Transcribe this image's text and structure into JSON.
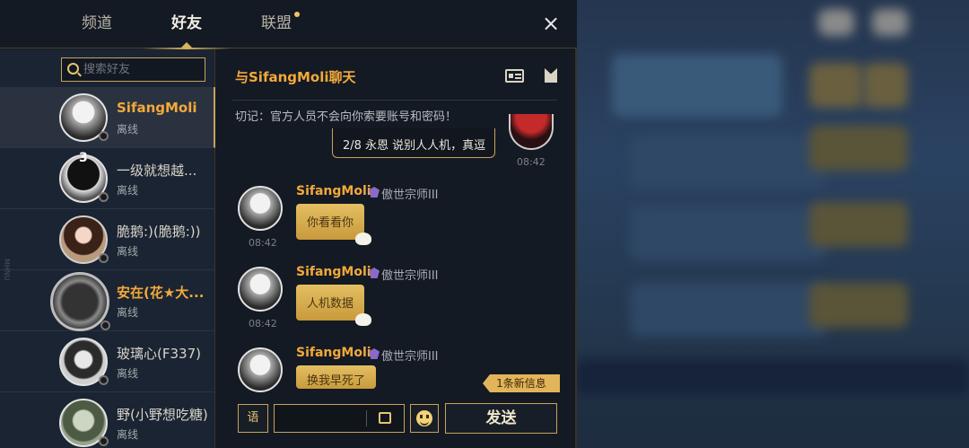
{
  "tabs": [
    {
      "label": "频道"
    },
    {
      "label": "好友"
    },
    {
      "label": "联盟"
    }
  ],
  "close_icon": "×",
  "search": {
    "placeholder": "搜索好友"
  },
  "side_label": "MHNU",
  "friends": [
    {
      "name": "SifangMoli",
      "status": "离线"
    },
    {
      "name": "一级就想越...",
      "status": "离线",
      "badge": "3"
    },
    {
      "name": "脆鹅:)(脆鹅:))",
      "status": "离线"
    },
    {
      "name": "安在(花★大...",
      "status": "离线"
    },
    {
      "name": "玻璃心(F337)",
      "status": "离线"
    },
    {
      "name": "野(小野想吃糖)",
      "status": "离线"
    }
  ],
  "chat": {
    "title": "与SifangMoli聊天",
    "warning": "切记：官方人员不会向你索要账号和密码！",
    "my_message": {
      "text": "2/8 永恩 说别人人机，真逗",
      "time": "08:42"
    },
    "messages": [
      {
        "name": "SifangMoli",
        "rank": "傲世宗师III",
        "text": "你看看你",
        "time": "08:42"
      },
      {
        "name": "SifangMoli",
        "rank": "傲世宗师III",
        "text": "人机数据",
        "time": "08:42"
      },
      {
        "name": "SifangMoli",
        "rank": "傲世宗师III",
        "text": "换我早死了",
        "time": ""
      }
    ],
    "new_message_notice": "1条新信息"
  },
  "input": {
    "voice_label": "语",
    "send_label": "发送"
  }
}
